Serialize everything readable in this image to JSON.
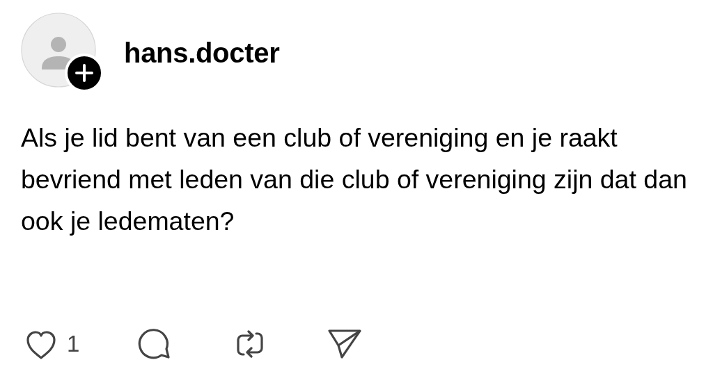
{
  "post": {
    "username": "hans.docter",
    "text": "Als je lid bent van een club of vereniging en je raakt bevriend met leden van die club of vereniging zijn dat dan ook je ledematen?",
    "likes": "1"
  }
}
